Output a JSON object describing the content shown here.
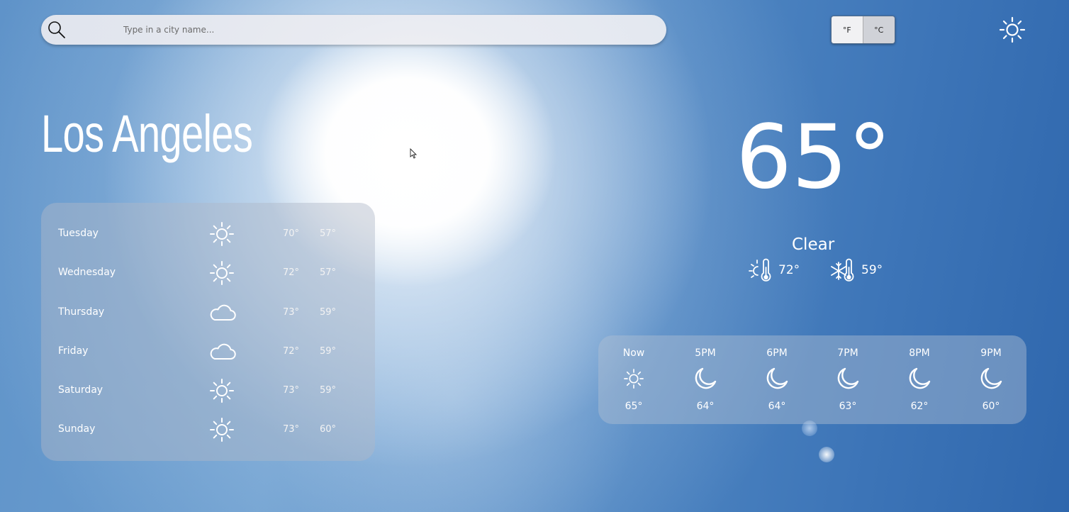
{
  "search": {
    "placeholder": "Type in a city name..."
  },
  "units": {
    "fahrenheit_label": "°F",
    "celsius_label": "°C"
  },
  "city": "Los Angeles",
  "current": {
    "temperature": "65°",
    "condition": "Clear",
    "high": "72°",
    "low": "59°"
  },
  "forecast": [
    {
      "day": "Tuesday",
      "icon": "sun-icon",
      "high": "70°",
      "low": "57°"
    },
    {
      "day": "Wednesday",
      "icon": "sun-icon",
      "high": "72°",
      "low": "57°"
    },
    {
      "day": "Thursday",
      "icon": "cloud-icon",
      "high": "73°",
      "low": "59°"
    },
    {
      "day": "Friday",
      "icon": "cloud-icon",
      "high": "72°",
      "low": "59°"
    },
    {
      "day": "Saturday",
      "icon": "sun-icon",
      "high": "73°",
      "low": "59°"
    },
    {
      "day": "Sunday",
      "icon": "sun-icon",
      "high": "73°",
      "low": "60°"
    }
  ],
  "hourly": [
    {
      "time": "Now",
      "icon": "sun-icon",
      "temp": "65°"
    },
    {
      "time": "5PM",
      "icon": "moon-icon",
      "temp": "64°"
    },
    {
      "time": "6PM",
      "icon": "moon-icon",
      "temp": "64°"
    },
    {
      "time": "7PM",
      "icon": "moon-icon",
      "temp": "63°"
    },
    {
      "time": "8PM",
      "icon": "moon-icon",
      "temp": "62°"
    },
    {
      "time": "9PM",
      "icon": "moon-icon",
      "temp": "60°"
    }
  ]
}
